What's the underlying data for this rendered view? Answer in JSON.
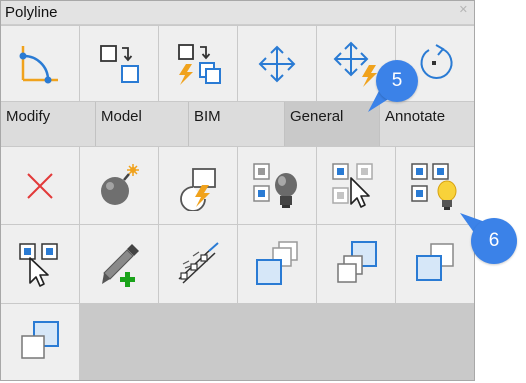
{
  "window": {
    "title": "Polyline"
  },
  "colors": {
    "accent_blue": "#3b82e8",
    "icon_blue": "#2a7bd4",
    "lightning": "#f0a21c",
    "cross_red": "#e23a3a",
    "plus_green": "#1aa31a"
  },
  "tabs": [
    {
      "label": "Modify",
      "active": false
    },
    {
      "label": "Model",
      "active": false
    },
    {
      "label": "BIM",
      "active": false
    },
    {
      "label": "General",
      "active": true
    },
    {
      "label": "Annotate",
      "active": false
    }
  ],
  "callouts": [
    {
      "label": "5"
    },
    {
      "label": "6"
    }
  ],
  "icons": {
    "row1": [
      "fillet-icon",
      "copy-icon",
      "copy-dynamic-icon",
      "move-icon",
      "move-dynamic-icon",
      "rotate-icon"
    ],
    "row2": [
      "delete-icon",
      "explode-icon",
      "quick-draw-icon",
      "isolate-objects-icon",
      "hide-objects-icon",
      "show-all-objects-icon"
    ],
    "row3": [
      "select-similar-icon",
      "match-properties-icon",
      "dimension-icon",
      "bring-to-front-icon",
      "send-to-back-icon",
      "bring-above-icon"
    ],
    "row4": [
      "send-under-icon"
    ]
  }
}
